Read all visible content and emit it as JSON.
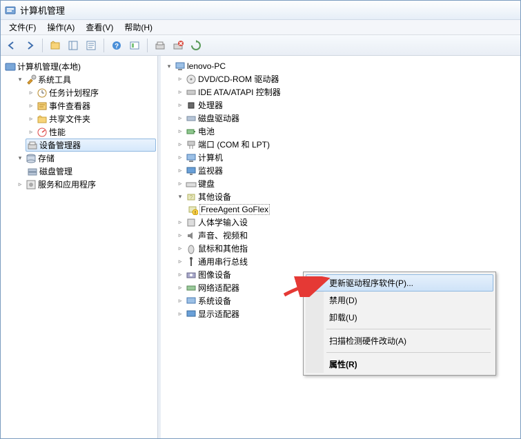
{
  "window": {
    "title": "计算机管理"
  },
  "menubar": {
    "file": "文件(F)",
    "action": "操作(A)",
    "view": "查看(V)",
    "help": "帮助(H)"
  },
  "leftTree": {
    "root": "计算机管理(本地)",
    "systemTools": "系统工具",
    "taskScheduler": "任务计划程序",
    "eventViewer": "事件查看器",
    "sharedFolders": "共享文件夹",
    "performance": "性能",
    "deviceManager": "设备管理器",
    "storage": "存储",
    "diskManagement": "磁盘管理",
    "servicesApps": "服务和应用程序"
  },
  "rightTree": {
    "root": "lenovo-PC",
    "dvd": "DVD/CD-ROM 驱动器",
    "ide": "IDE ATA/ATAPI 控制器",
    "cpu": "处理器",
    "diskDrives": "磁盘驱动器",
    "battery": "电池",
    "ports": "端口 (COM 和 LPT)",
    "computer": "计算机",
    "monitor": "监视器",
    "keyboard": "键盘",
    "otherDevices": "其他设备",
    "otherChild": "FreeAgent GoFlex",
    "hid": "人体学输入设",
    "sound": "声音、视频和",
    "mouse": "鼠标和其他指",
    "usb": "通用串行总线",
    "imaging": "图像设备",
    "network": "网络适配器",
    "system": "系统设备",
    "display": "显示适配器"
  },
  "contextMenu": {
    "update": "更新驱动程序软件(P)...",
    "disable": "禁用(D)",
    "uninstall": "卸载(U)",
    "scan": "扫描检测硬件改动(A)",
    "properties": "属性(R)"
  },
  "colors": {
    "accent": "#3f6fae",
    "arrow": "#e53935"
  }
}
